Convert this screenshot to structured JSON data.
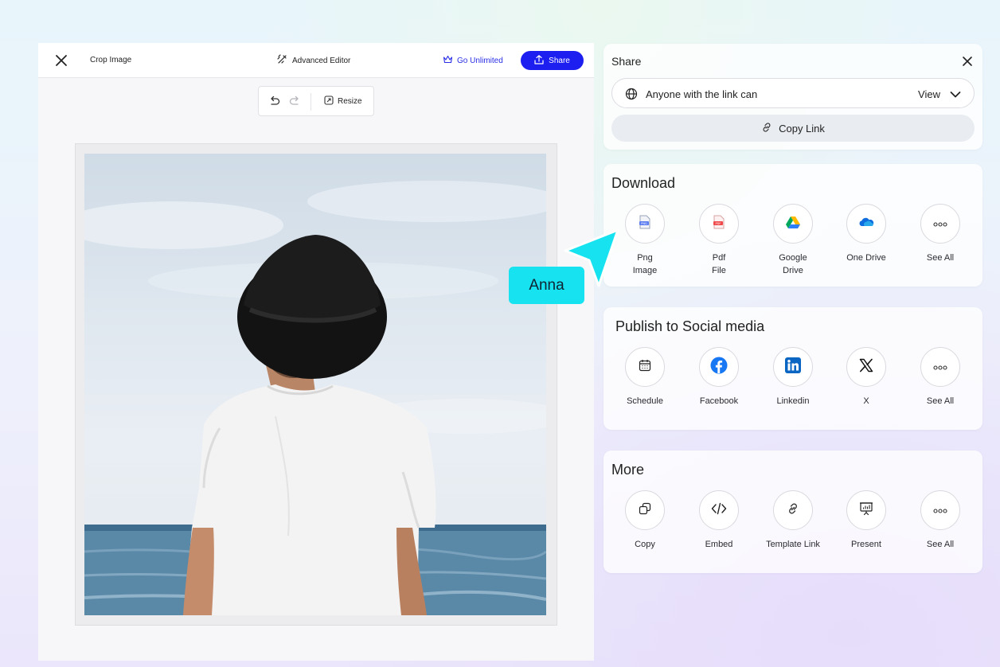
{
  "editor": {
    "title": "Crop Image",
    "advanced_editor": "Advanced Editor",
    "go_unlimited": "Go Unlimited",
    "share_button": "Share",
    "toolbar": {
      "resize": "Resize"
    }
  },
  "share_panel": {
    "title": "Share",
    "access_label": "Anyone with the link can",
    "access_value": "View",
    "copy_link": "Copy Link"
  },
  "download": {
    "title": "Download",
    "items": [
      {
        "label_line1": "Png",
        "label_line2": "Image",
        "icon": "png-file-icon"
      },
      {
        "label_line1": "Pdf",
        "label_line2": "File",
        "icon": "pdf-file-icon"
      },
      {
        "label_line1": "Google",
        "label_line2": "Drive",
        "icon": "google-drive-icon"
      },
      {
        "label_line1": "One Drive",
        "label_line2": "",
        "icon": "onedrive-icon"
      },
      {
        "label_line1": "See All",
        "label_line2": "",
        "icon": "more-icon"
      }
    ]
  },
  "social": {
    "title": "Publish to Social media",
    "items": [
      {
        "label": "Schedule",
        "icon": "calendar-icon"
      },
      {
        "label": "Facebook",
        "icon": "facebook-icon"
      },
      {
        "label": "Linkedin",
        "icon": "linkedin-icon"
      },
      {
        "label": "X",
        "icon": "x-icon"
      },
      {
        "label": "See All",
        "icon": "more-icon"
      }
    ]
  },
  "more": {
    "title": "More",
    "items": [
      {
        "label": "Copy",
        "icon": "copy-icon"
      },
      {
        "label": "Embed",
        "icon": "code-icon"
      },
      {
        "label": "Template Link",
        "icon": "link-icon"
      },
      {
        "label": "Present",
        "icon": "presentation-icon"
      },
      {
        "label": "See All",
        "icon": "more-icon"
      }
    ]
  },
  "collaborator": {
    "name": "Anna",
    "color": "#17e3f0"
  },
  "colors": {
    "accent": "#1d1ef0",
    "facebook": "#1877f2",
    "linkedin": "#0a66c2"
  }
}
